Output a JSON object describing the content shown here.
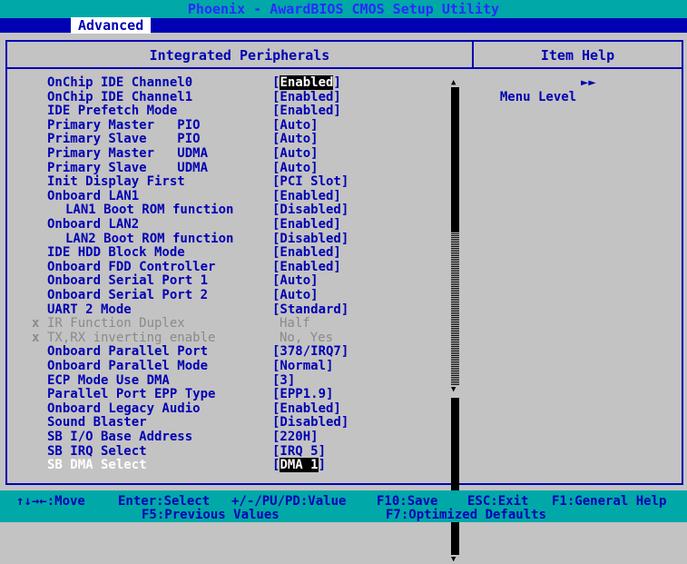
{
  "app_title": "Phoenix - AwardBIOS CMOS Setup Utility",
  "menu_tab": "Advanced",
  "section_title": "Integrated Peripherals",
  "help_title": "Item Help",
  "help": {
    "menu_level_label": "Menu Level",
    "menu_level_arrow": "►►"
  },
  "settings": [
    {
      "label": "OnChip IDE Channel0",
      "value": "[Enabled]",
      "state": "highlighted"
    },
    {
      "label": "OnChip IDE Channel1",
      "value": "[Enabled]"
    },
    {
      "label": "IDE Prefetch Mode",
      "value": "[Enabled]"
    },
    {
      "label": "Primary Master   PIO",
      "value": "[Auto]"
    },
    {
      "label": "Primary Slave    PIO",
      "value": "[Auto]"
    },
    {
      "label": "Primary Master   UDMA",
      "value": "[Auto]"
    },
    {
      "label": "Primary Slave    UDMA",
      "value": "[Auto]"
    },
    {
      "label": "Init Display First",
      "value": "[PCI Slot]"
    },
    {
      "label": "Onboard LAN1",
      "value": "[Enabled]"
    },
    {
      "label": "LAN1 Boot ROM function",
      "value": "[Disabled]",
      "indent": true
    },
    {
      "label": "Onboard LAN2",
      "value": "[Enabled]"
    },
    {
      "label": "LAN2 Boot ROM function",
      "value": "[Disabled]",
      "indent": true
    },
    {
      "label": "IDE HDD Block Mode",
      "value": "[Enabled]"
    },
    {
      "label": "Onboard FDD Controller",
      "value": "[Enabled]"
    },
    {
      "label": "Onboard Serial Port 1",
      "value": "[Auto]"
    },
    {
      "label": "Onboard Serial Port 2",
      "value": "[Auto]"
    },
    {
      "label": "UART 2 Mode",
      "value": "[Standard]"
    },
    {
      "label": "IR Function Duplex",
      "value": "Half",
      "state": "disabled",
      "mark": "x"
    },
    {
      "label": "TX,RX inverting enable",
      "value": "No, Yes",
      "state": "disabled",
      "mark": "x"
    },
    {
      "label": "Onboard Parallel Port",
      "value": "[378/IRQ7]"
    },
    {
      "label": "Onboard Parallel Mode",
      "value": "[Normal]"
    },
    {
      "label": "ECP Mode Use DMA",
      "value": "[3]"
    },
    {
      "label": "Parallel Port EPP Type",
      "value": "[EPP1.9]"
    },
    {
      "label": "Onboard Legacy Audio",
      "value": "[Enabled]"
    },
    {
      "label": "Sound Blaster",
      "value": "[Disabled]"
    },
    {
      "label": "SB I/O Base Address",
      "value": "[220H]"
    },
    {
      "label": "SB IRQ Select",
      "value": "[IRQ 5]"
    },
    {
      "label": "SB DMA Select",
      "value": "[DMA 1]",
      "state": "selected"
    }
  ],
  "status": {
    "move": "↑↓→←:Move",
    "enter": "Enter:Select",
    "value": "+/-/PU/PD:Value",
    "save": "F10:Save",
    "exit": "ESC:Exit",
    "help": "F1:General Help",
    "prev": "F5:Previous Values",
    "defaults": "F7:Optimized Defaults"
  },
  "colors": {
    "bg": "#c3c3c3",
    "text": "#0000b4",
    "bar": "#00a8a8",
    "highlight": "#000000"
  }
}
